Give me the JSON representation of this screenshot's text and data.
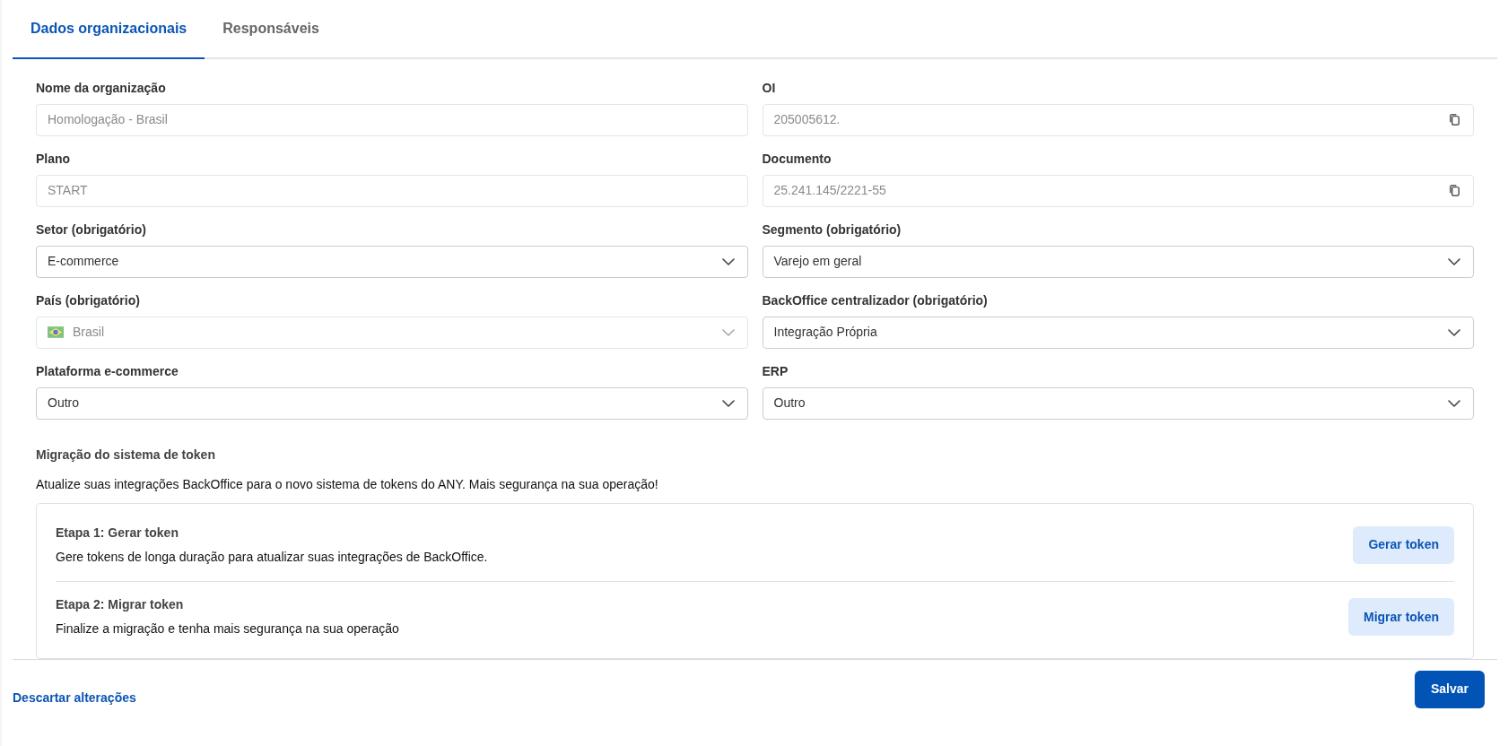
{
  "tabs": [
    {
      "label": "Dados organizacionais",
      "selected": true
    },
    {
      "label": "Responsáveis",
      "selected": false
    }
  ],
  "fields": [
    {
      "label": "Nome da organização",
      "value": "Homologação - Brasil",
      "kind": "text",
      "disabled": true
    },
    {
      "label": "OI",
      "value": "205005612.",
      "kind": "copyable",
      "disabled": true
    },
    {
      "label": "Plano",
      "value": "START",
      "kind": "text",
      "disabled": true
    },
    {
      "label": "Documento",
      "value": "25.241.145/2221-55",
      "kind": "copyable",
      "disabled": true
    },
    {
      "label": "Setor (obrigatório)",
      "value": "E-commerce",
      "kind": "select",
      "disabled": false
    },
    {
      "label": "Segmento (obrigatório)",
      "value": "Varejo em geral",
      "kind": "select",
      "disabled": false
    },
    {
      "label": "País (obrigatório)",
      "value": "Brasil",
      "kind": "country_select",
      "disabled": true
    },
    {
      "label": "BackOffice centralizador (obrigatório)",
      "value": "Integração Própria",
      "kind": "select",
      "disabled": false
    },
    {
      "label": "Plataforma e-commerce",
      "value": "Outro",
      "kind": "select",
      "disabled": false
    },
    {
      "label": "ERP",
      "value": "Outro",
      "kind": "select",
      "disabled": false
    }
  ],
  "token_migration": {
    "title": "Migração do sistema de token",
    "description": "Atualize suas integrações BackOffice para o novo sistema de tokens do ANY. Mais segurança na sua operação!",
    "steps": [
      {
        "title": "Etapa 1: Gerar token",
        "description": "Gere tokens de longa duração para atualizar suas integrações de BackOffice.",
        "button": "Gerar token"
      },
      {
        "title": "Etapa 2: Migrar token",
        "description": "Finalize a migração e tenha mais segurança na sua operação",
        "button": "Migrar token"
      }
    ]
  },
  "footer": {
    "discard_link": "Descartar alterações",
    "save_button": "Salvar"
  }
}
